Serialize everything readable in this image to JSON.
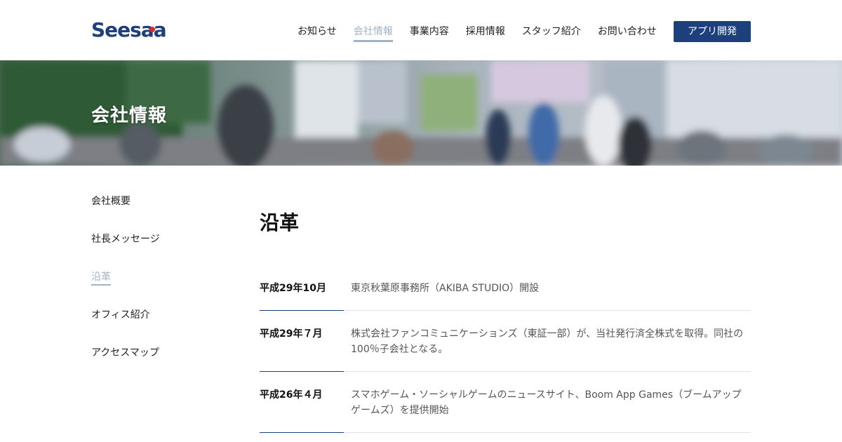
{
  "header": {
    "logo_text": "Seesaa",
    "nav": [
      {
        "label": "お知らせ"
      },
      {
        "label": "会社情報"
      },
      {
        "label": "事業内容"
      },
      {
        "label": "採用情報"
      },
      {
        "label": "スタッフ紹介"
      },
      {
        "label": "お問い合わせ"
      }
    ],
    "cta_label": "アプリ開発"
  },
  "hero": {
    "title": "会社情報"
  },
  "sidebar": {
    "items": [
      {
        "label": "会社概要"
      },
      {
        "label": "社長メッセージ"
      },
      {
        "label": "沿革"
      },
      {
        "label": "オフィス紹介"
      },
      {
        "label": "アクセスマップ"
      }
    ]
  },
  "main": {
    "title": "沿革",
    "history": [
      {
        "date": "平成29年10月",
        "text": "東京秋葉原事務所（AKIBA STUDIO）開設"
      },
      {
        "date": "平成29年７月",
        "text": "株式会社ファンコミュニケーションズ（東証一部）が、当社発行済全株式を取得。同社の100％子会社となる。"
      },
      {
        "date": "平成26年４月",
        "text": "スマホゲーム・ソーシャルゲームのニュースサイト、Boom App Games（ブームアップ ゲームズ）を提供開始"
      }
    ]
  },
  "colors": {
    "brand": "#1d3f7c",
    "accent_red": "#e0262e",
    "active_link": "#9fb3c8"
  }
}
